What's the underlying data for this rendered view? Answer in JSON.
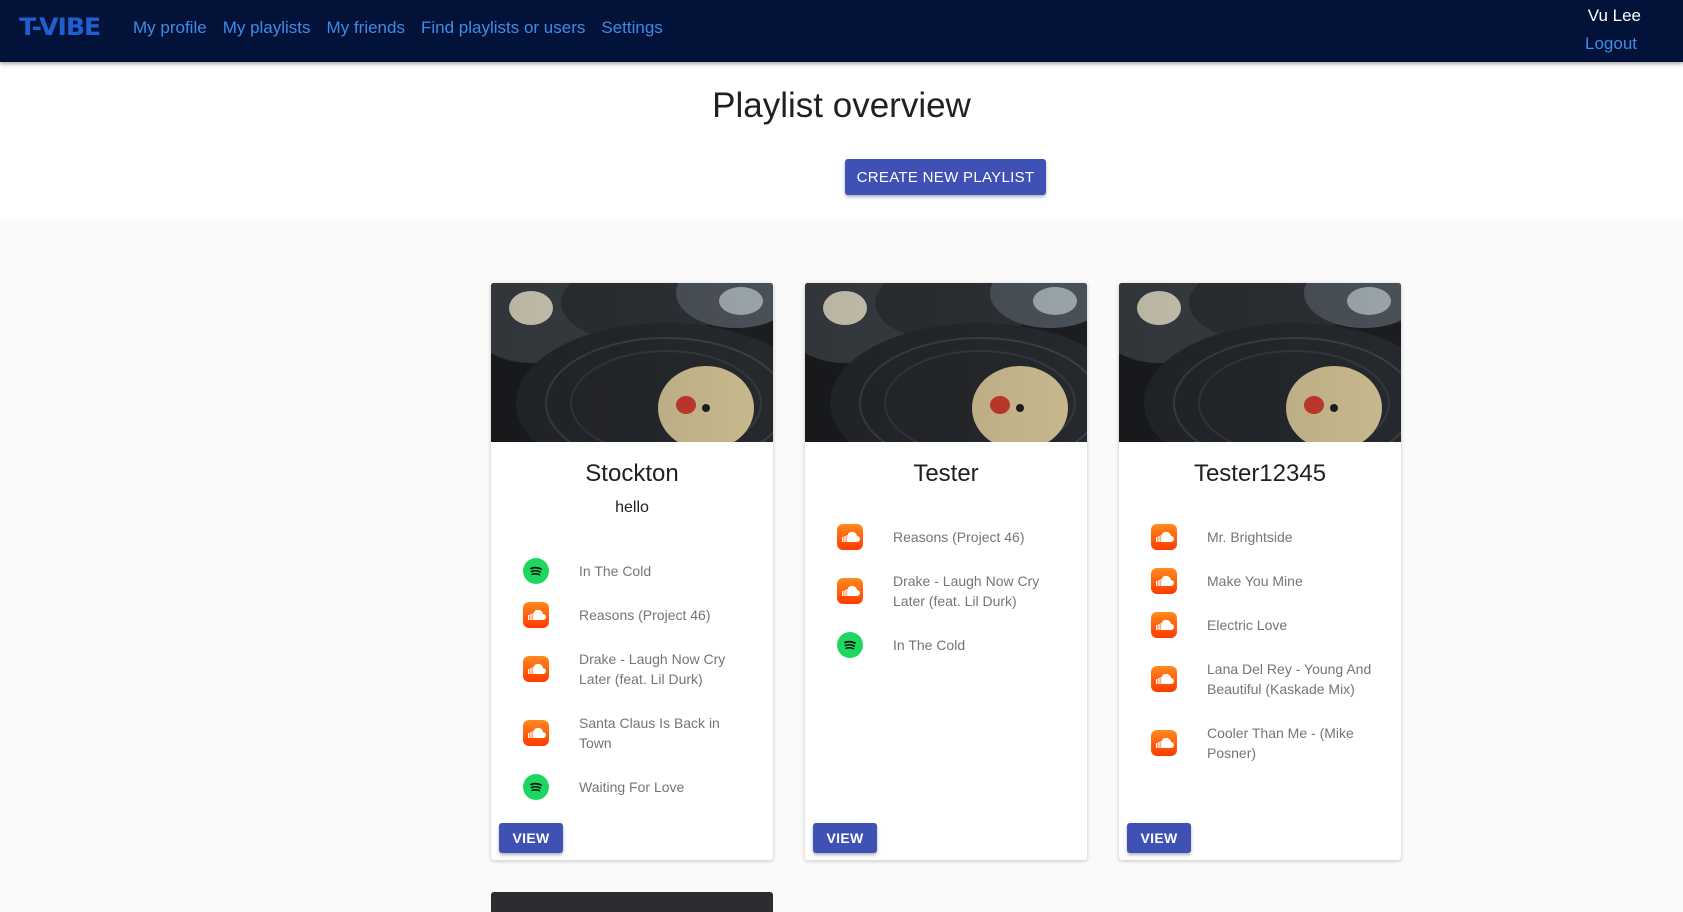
{
  "nav": {
    "logo": "T-VIBE",
    "links": [
      "My profile",
      "My playlists",
      "My friends",
      "Find playlists or users",
      "Settings"
    ],
    "user_name": "Vu Lee",
    "logout": "Logout"
  },
  "header": {
    "title": "Playlist overview",
    "create_button": "CREATE NEW PLAYLIST"
  },
  "colors": {
    "navbar": "#021238",
    "link": "#3f8ce8",
    "primary_button": "#3f51b5",
    "soundcloud": "#ff5500",
    "spotify": "#1ed760"
  },
  "playlists": [
    {
      "title": "Stockton",
      "description": "hello",
      "songs": [
        {
          "source": "spotify-icon",
          "title": "In The Cold"
        },
        {
          "source": "soundcloud-icon",
          "title": "Reasons (Project 46)"
        },
        {
          "source": "soundcloud-icon",
          "title": "Drake - Laugh Now Cry Later (feat. Lil Durk)"
        },
        {
          "source": "soundcloud-icon",
          "title": "Santa Claus Is Back in Town"
        },
        {
          "source": "spotify-icon",
          "title": "Waiting For Love"
        }
      ],
      "view_button": "VIEW"
    },
    {
      "title": "Tester",
      "description": "",
      "songs": [
        {
          "source": "soundcloud-icon",
          "title": "Reasons (Project 46)"
        },
        {
          "source": "soundcloud-icon",
          "title": "Drake - Laugh Now Cry Later (feat. Lil Durk)"
        },
        {
          "source": "spotify-icon",
          "title": "In The Cold"
        }
      ],
      "view_button": "VIEW"
    },
    {
      "title": "Tester12345",
      "description": "",
      "songs": [
        {
          "source": "soundcloud-icon",
          "title": "Mr. Brightside"
        },
        {
          "source": "soundcloud-icon",
          "title": "Make You Mine"
        },
        {
          "source": "soundcloud-icon",
          "title": "Electric Love"
        },
        {
          "source": "soundcloud-icon",
          "title": "Lana Del Rey - Young And Beautiful (Kaskade Mix)"
        },
        {
          "source": "soundcloud-icon",
          "title": "Cooler Than Me - (Mike Posner)"
        }
      ],
      "view_button": "VIEW"
    }
  ]
}
